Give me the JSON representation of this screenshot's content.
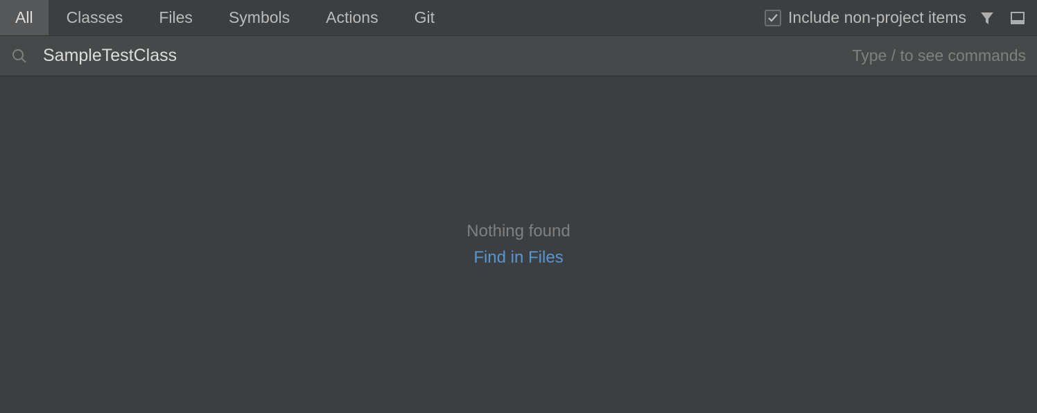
{
  "tabs": [
    {
      "label": "All",
      "active": true
    },
    {
      "label": "Classes",
      "active": false
    },
    {
      "label": "Files",
      "active": false
    },
    {
      "label": "Symbols",
      "active": false
    },
    {
      "label": "Actions",
      "active": false
    },
    {
      "label": "Git",
      "active": false
    }
  ],
  "checkbox": {
    "include_non_project_label": "Include non-project items",
    "checked": true
  },
  "search": {
    "value": "SampleTestClass",
    "hint": "Type / to see commands"
  },
  "results": {
    "empty_message": "Nothing found",
    "find_in_files_label": "Find in Files"
  }
}
